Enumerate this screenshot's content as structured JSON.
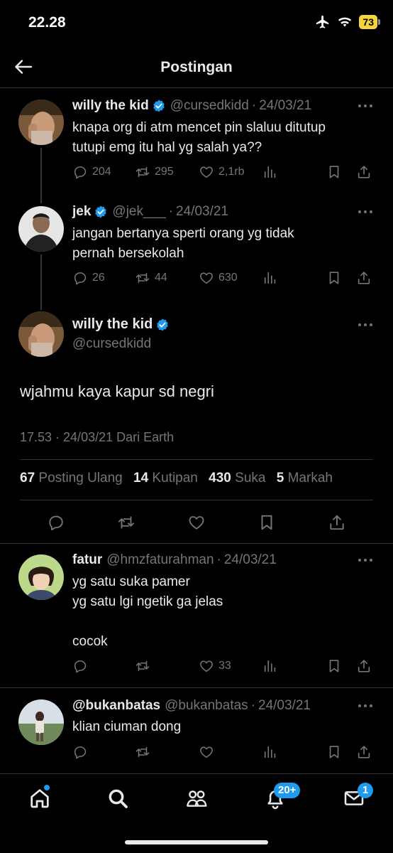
{
  "status_bar": {
    "time": "22.28",
    "battery": "73"
  },
  "header": {
    "title": "Postingan"
  },
  "thread": [
    {
      "name": "willy the kid",
      "handle": "@cursedkidd",
      "date": "24/03/21",
      "text": "knapa org di atm mencet pin slaluu ditutup\ntutupi emg itu hal yg salah ya??",
      "replies": "204",
      "reposts": "295",
      "likes": "2,1rb"
    },
    {
      "name": "jek",
      "handle": "@jek___",
      "date": "24/03/21",
      "text": "jangan bertanya sperti orang yg tidak\npernah bersekolah",
      "replies": "26",
      "reposts": "44",
      "likes": "630"
    }
  ],
  "main_post": {
    "name": "willy the kid",
    "handle": "@cursedkidd",
    "text": "wjahmu kaya kapur sd negri",
    "meta": "17.53 · 24/03/21 Dari Earth",
    "stats": [
      {
        "count": "67",
        "label": "Posting Ulang"
      },
      {
        "count": "14",
        "label": "Kutipan"
      },
      {
        "count": "430",
        "label": "Suka"
      },
      {
        "count": "5",
        "label": "Markah"
      }
    ]
  },
  "replies": [
    {
      "name": "fatur",
      "handle": "@hmzfaturahman",
      "date": "24/03/21",
      "text": "yg satu suka pamer\nyg satu lgi ngetik ga jelas\n\ncocok",
      "likes": "33"
    },
    {
      "name": "@bukanbatas",
      "handle": "@bukanbatas",
      "date": "24/03/21",
      "text": "klian ciuman dong"
    }
  ],
  "nav": {
    "notifications_badge": "20+",
    "messages_badge": "1"
  },
  "colors": {
    "accent": "#1d9bf0",
    "muted": "#71767b",
    "text": "#e7e9ea",
    "background": "#000000"
  }
}
